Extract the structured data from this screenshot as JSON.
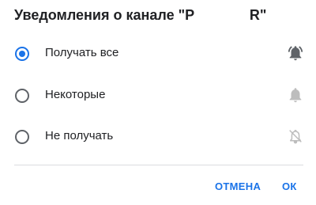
{
  "dialog": {
    "title": "Уведомления о канале \"P              R\"",
    "options": [
      {
        "label": "Получать все",
        "selected": true,
        "icon": "bell-ring-icon"
      },
      {
        "label": "Некоторые",
        "selected": false,
        "icon": "bell-icon"
      },
      {
        "label": "Не получать",
        "selected": false,
        "icon": "bell-off-icon"
      }
    ],
    "buttons": {
      "cancel": "ОТМЕНА",
      "ok": "ОК"
    }
  },
  "colors": {
    "accent": "#1a73e8",
    "radio_off": "#5f6368",
    "icon_active": "#5f6368",
    "icon_inactive": "#bdbdbd",
    "divider": "#dadce0"
  }
}
